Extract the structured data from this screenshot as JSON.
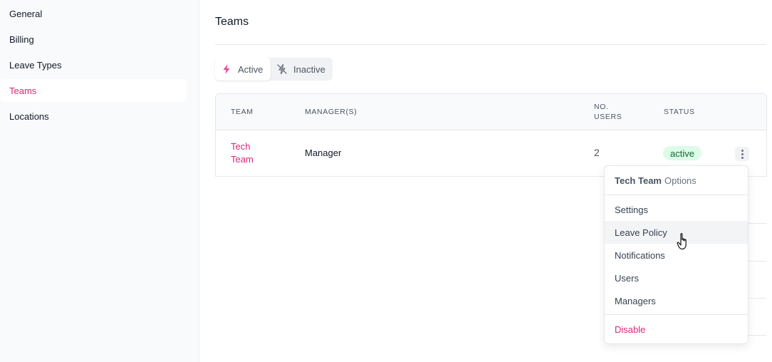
{
  "sidebar": {
    "items": [
      {
        "label": "General"
      },
      {
        "label": "Billing"
      },
      {
        "label": "Leave Types"
      },
      {
        "label": "Teams"
      },
      {
        "label": "Locations"
      }
    ],
    "active_index": 3
  },
  "main": {
    "title": "Teams",
    "filter": {
      "active_label": "Active",
      "inactive_label": "Inactive"
    },
    "table": {
      "headers": {
        "team": "TEAM",
        "managers": "MANAGER(S)",
        "users_line1": "NO.",
        "users_line2": "USERS",
        "status": "STATUS"
      },
      "rows": [
        {
          "team": "Tech Team",
          "manager": "Manager",
          "users": "2",
          "status": "active"
        }
      ]
    }
  },
  "menu": {
    "header_name": "Tech Team",
    "header_suffix": "Options",
    "items": [
      {
        "label": "Settings"
      },
      {
        "label": "Leave Policy"
      },
      {
        "label": "Notifications"
      },
      {
        "label": "Users"
      },
      {
        "label": "Managers"
      }
    ],
    "danger_label": "Disable"
  },
  "colors": {
    "accent": "#db2777",
    "status_bg": "#dcfce7",
    "status_text": "#166534"
  },
  "icons": {
    "active": "lightning-icon",
    "inactive": "lightning-slash-icon",
    "row_menu": "more-vertical-icon",
    "cursor": "hand-pointer-icon"
  }
}
